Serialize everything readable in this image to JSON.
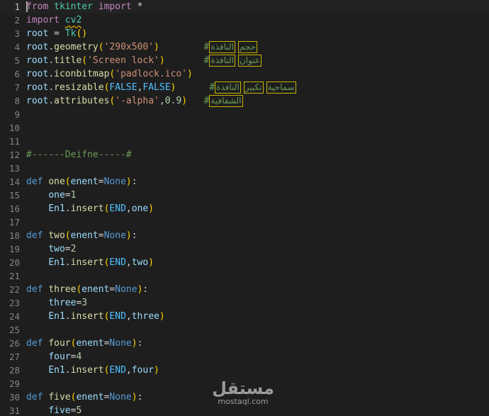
{
  "editor": {
    "lines": [
      {
        "n": "1",
        "tokens": [
          [
            "kw",
            "from"
          ],
          [
            "pl",
            " "
          ],
          [
            "cls",
            "tkinter"
          ],
          [
            "pl",
            " "
          ],
          [
            "kw",
            "import"
          ],
          [
            "pl",
            " *"
          ]
        ]
      },
      {
        "n": "2",
        "tokens": [
          [
            "kw",
            "import"
          ],
          [
            "pl",
            " "
          ],
          [
            "cls squig",
            "cv2"
          ]
        ]
      },
      {
        "n": "3",
        "tokens": [
          [
            "var",
            "root"
          ],
          [
            "pl",
            " = "
          ],
          [
            "cls",
            "Tk"
          ],
          [
            "br1",
            "()"
          ]
        ]
      },
      {
        "n": "4",
        "tokens": [
          [
            "var",
            "root"
          ],
          [
            "pl",
            "."
          ],
          [
            "fn",
            "geometry"
          ],
          [
            "br1",
            "("
          ],
          [
            "str",
            "'290x500'"
          ],
          [
            "br1",
            ")"
          ],
          [
            "pl",
            "        "
          ],
          [
            "cmt",
            "#"
          ],
          [
            "ar",
            "النافذة"
          ],
          [
            "ar",
            "حجم"
          ]
        ]
      },
      {
        "n": "5",
        "tokens": [
          [
            "var",
            "root"
          ],
          [
            "pl",
            "."
          ],
          [
            "fn",
            "title"
          ],
          [
            "br1",
            "("
          ],
          [
            "str",
            "'Screen lock'"
          ],
          [
            "br1",
            ")"
          ],
          [
            "pl",
            "       "
          ],
          [
            "cmt",
            "#"
          ],
          [
            "ar",
            "النافذة"
          ],
          [
            "ar",
            "عنوان"
          ]
        ]
      },
      {
        "n": "6",
        "tokens": [
          [
            "var",
            "root"
          ],
          [
            "pl",
            "."
          ],
          [
            "fn",
            "iconbitmap"
          ],
          [
            "br1",
            "("
          ],
          [
            "str",
            "'padlock.ico'"
          ],
          [
            "br1",
            ")"
          ]
        ]
      },
      {
        "n": "7",
        "tokens": [
          [
            "var",
            "root"
          ],
          [
            "pl",
            "."
          ],
          [
            "fn",
            "resizable"
          ],
          [
            "br1",
            "("
          ],
          [
            "const",
            "FALSE"
          ],
          [
            "pl",
            ","
          ],
          [
            "const",
            "FALSE"
          ],
          [
            "br1",
            ")"
          ],
          [
            "pl",
            "      "
          ],
          [
            "cmt",
            "#"
          ],
          [
            "ar",
            "النافذة"
          ],
          [
            "ar",
            "تكبير"
          ],
          [
            "ar",
            "سماحية"
          ]
        ]
      },
      {
        "n": "8",
        "tokens": [
          [
            "var",
            "root"
          ],
          [
            "pl",
            "."
          ],
          [
            "fn",
            "attributes"
          ],
          [
            "br1",
            "("
          ],
          [
            "str",
            "'-alpha'"
          ],
          [
            "pl",
            ","
          ],
          [
            "num",
            "0.9"
          ],
          [
            "br1",
            ")"
          ],
          [
            "pl",
            "   "
          ],
          [
            "cmt",
            "#"
          ],
          [
            "ar",
            "الشفافية"
          ]
        ]
      },
      {
        "n": "9",
        "tokens": []
      },
      {
        "n": "10",
        "tokens": []
      },
      {
        "n": "11",
        "tokens": []
      },
      {
        "n": "12",
        "tokens": [
          [
            "cmt",
            "#------Deifne-----#"
          ]
        ]
      },
      {
        "n": "13",
        "tokens": []
      },
      {
        "n": "14",
        "tokens": [
          [
            "def",
            "def"
          ],
          [
            "pl",
            " "
          ],
          [
            "fn",
            "one"
          ],
          [
            "br1",
            "("
          ],
          [
            "var",
            "enent"
          ],
          [
            "pl",
            "="
          ],
          [
            "def",
            "None"
          ],
          [
            "br1",
            ")"
          ],
          [
            "pl",
            ":"
          ]
        ]
      },
      {
        "n": "15",
        "tokens": [
          [
            "pl",
            "    "
          ],
          [
            "var",
            "one"
          ],
          [
            "pl",
            "="
          ],
          [
            "num",
            "1"
          ]
        ]
      },
      {
        "n": "16",
        "tokens": [
          [
            "pl",
            "    "
          ],
          [
            "var",
            "En1"
          ],
          [
            "pl",
            "."
          ],
          [
            "fn",
            "insert"
          ],
          [
            "br1",
            "("
          ],
          [
            "const",
            "END"
          ],
          [
            "pl",
            ","
          ],
          [
            "var",
            "one"
          ],
          [
            "br1",
            ")"
          ]
        ]
      },
      {
        "n": "17",
        "tokens": []
      },
      {
        "n": "18",
        "tokens": [
          [
            "def",
            "def"
          ],
          [
            "pl",
            " "
          ],
          [
            "fn",
            "two"
          ],
          [
            "br1",
            "("
          ],
          [
            "var",
            "enent"
          ],
          [
            "pl",
            "="
          ],
          [
            "def",
            "None"
          ],
          [
            "br1",
            ")"
          ],
          [
            "pl",
            ":"
          ]
        ]
      },
      {
        "n": "19",
        "tokens": [
          [
            "pl",
            "    "
          ],
          [
            "var",
            "two"
          ],
          [
            "pl",
            "="
          ],
          [
            "num",
            "2"
          ]
        ]
      },
      {
        "n": "20",
        "tokens": [
          [
            "pl",
            "    "
          ],
          [
            "var",
            "En1"
          ],
          [
            "pl",
            "."
          ],
          [
            "fn",
            "insert"
          ],
          [
            "br1",
            "("
          ],
          [
            "const",
            "END"
          ],
          [
            "pl",
            ","
          ],
          [
            "var",
            "two"
          ],
          [
            "br1",
            ")"
          ]
        ]
      },
      {
        "n": "21",
        "tokens": []
      },
      {
        "n": "22",
        "tokens": [
          [
            "def",
            "def"
          ],
          [
            "pl",
            " "
          ],
          [
            "fn",
            "three"
          ],
          [
            "br1",
            "("
          ],
          [
            "var",
            "enent"
          ],
          [
            "pl",
            "="
          ],
          [
            "def",
            "None"
          ],
          [
            "br1",
            ")"
          ],
          [
            "pl",
            ":"
          ]
        ]
      },
      {
        "n": "23",
        "tokens": [
          [
            "pl",
            "    "
          ],
          [
            "var",
            "three"
          ],
          [
            "pl",
            "="
          ],
          [
            "num",
            "3"
          ]
        ]
      },
      {
        "n": "24",
        "tokens": [
          [
            "pl",
            "    "
          ],
          [
            "var",
            "En1"
          ],
          [
            "pl",
            "."
          ],
          [
            "fn",
            "insert"
          ],
          [
            "br1",
            "("
          ],
          [
            "const",
            "END"
          ],
          [
            "pl",
            ","
          ],
          [
            "var",
            "three"
          ],
          [
            "br1",
            ")"
          ]
        ]
      },
      {
        "n": "25",
        "tokens": []
      },
      {
        "n": "26",
        "tokens": [
          [
            "def",
            "def"
          ],
          [
            "pl",
            " "
          ],
          [
            "fn",
            "four"
          ],
          [
            "br1",
            "("
          ],
          [
            "var",
            "enent"
          ],
          [
            "pl",
            "="
          ],
          [
            "def",
            "None"
          ],
          [
            "br1",
            ")"
          ],
          [
            "pl",
            ":"
          ]
        ]
      },
      {
        "n": "27",
        "tokens": [
          [
            "pl",
            "    "
          ],
          [
            "var",
            "four"
          ],
          [
            "pl",
            "="
          ],
          [
            "num",
            "4"
          ]
        ]
      },
      {
        "n": "28",
        "tokens": [
          [
            "pl",
            "    "
          ],
          [
            "var",
            "En1"
          ],
          [
            "pl",
            "."
          ],
          [
            "fn",
            "insert"
          ],
          [
            "br1",
            "("
          ],
          [
            "const",
            "END"
          ],
          [
            "pl",
            ","
          ],
          [
            "var",
            "four"
          ],
          [
            "br1",
            ")"
          ]
        ]
      },
      {
        "n": "29",
        "tokens": []
      },
      {
        "n": "30",
        "tokens": [
          [
            "def",
            "def"
          ],
          [
            "pl",
            " "
          ],
          [
            "fn",
            "five"
          ],
          [
            "br1",
            "("
          ],
          [
            "var",
            "enent"
          ],
          [
            "pl",
            "="
          ],
          [
            "def",
            "None"
          ],
          [
            "br1",
            ")"
          ],
          [
            "pl",
            ":"
          ]
        ]
      },
      {
        "n": "31",
        "tokens": [
          [
            "pl",
            "    "
          ],
          [
            "var",
            "five"
          ],
          [
            "pl",
            "="
          ],
          [
            "num",
            "5"
          ]
        ]
      }
    ],
    "current_line": 1
  },
  "watermark": {
    "logo": "مستقل",
    "url": "mostaql.com"
  },
  "colors": {
    "background": "#1e1e1e",
    "keyword": "#c586c0",
    "function": "#dcdcaa",
    "variable": "#9cdcfe",
    "string": "#ce9178",
    "comment": "#6a9955",
    "constant": "#4fc1ff"
  }
}
